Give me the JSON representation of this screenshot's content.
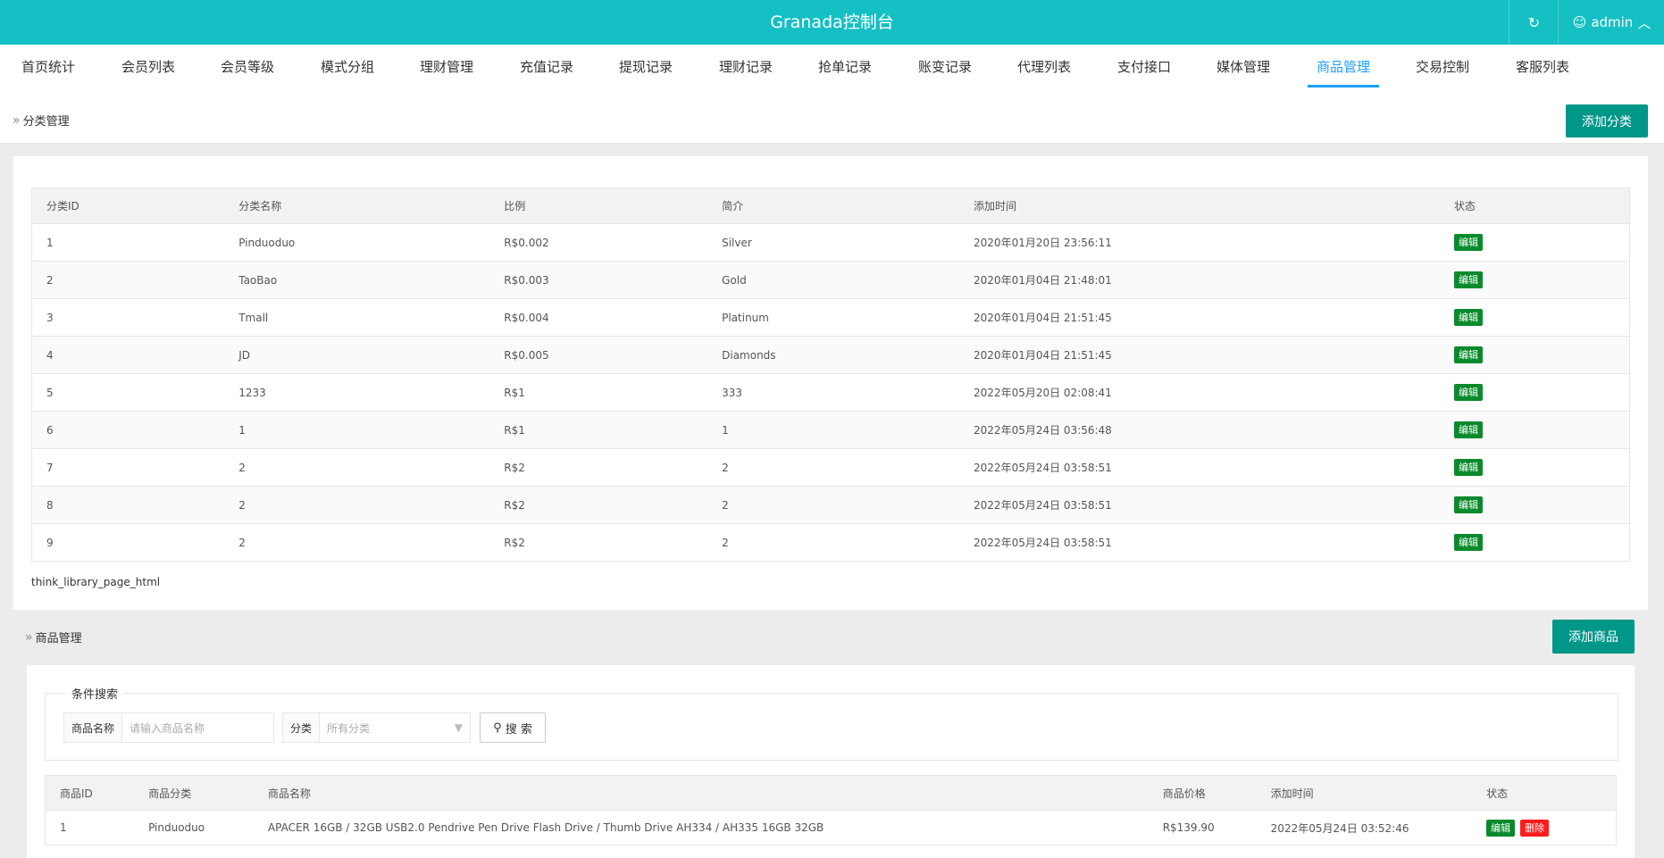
{
  "app": {
    "title": "Granada控制台",
    "user": "admin",
    "colors": {
      "header": "#15c0c4",
      "accent": "#1E9FFF",
      "primary_button": "#009688",
      "edit_tag": "#0a8a2c",
      "delete_tag": "#ff1c1c"
    }
  },
  "nav": {
    "items": [
      "首页统计",
      "会员列表",
      "会员等级",
      "模式分组",
      "理财管理",
      "充值记录",
      "提现记录",
      "理财记录",
      "抢单记录",
      "账变记录",
      "代理列表",
      "支付接口",
      "媒体管理",
      "商品管理",
      "交易控制",
      "客服列表"
    ],
    "active": "商品管理"
  },
  "category": {
    "breadcrumb": "分类管理",
    "add_button": "添加分类",
    "columns": [
      "分类ID",
      "分类名称",
      "比例",
      "简介",
      "添加时间",
      "状态"
    ],
    "rows": [
      [
        "1",
        "Pinduoduo",
        "R$0.002",
        "Silver",
        "2020年01月20日 23:56:11"
      ],
      [
        "2",
        "TaoBao",
        "R$0.003",
        "Gold",
        "2020年01月04日 21:48:01"
      ],
      [
        "3",
        "Tmall",
        "R$0.004",
        "Platinum",
        "2020年01月04日 21:51:45"
      ],
      [
        "4",
        "JD",
        "R$0.005",
        "Diamonds",
        "2020年01月04日 21:51:45"
      ],
      [
        "5",
        "1233",
        "R$1",
        "333",
        "2022年05月20日 02:08:41"
      ],
      [
        "6",
        "1",
        "R$1",
        "1",
        "2022年05月24日 03:56:48"
      ],
      [
        "7",
        "2",
        "R$2",
        "2",
        "2022年05月24日 03:58:51"
      ],
      [
        "8",
        "2",
        "R$2",
        "2",
        "2022年05月24日 03:58:51"
      ],
      [
        "9",
        "2",
        "R$2",
        "2",
        "2022年05月24日 03:58:51"
      ]
    ],
    "edit_label": "编辑",
    "pager_text": "think_library_page_html"
  },
  "goods": {
    "breadcrumb": "商品管理",
    "add_button": "添加商品",
    "search": {
      "legend": "条件搜索",
      "name_label": "商品名称",
      "name_placeholder": "请输入商品名称",
      "category_label": "分类",
      "category_value": "所有分类",
      "button": "搜 索"
    },
    "columns": [
      "商品ID",
      "商品分类",
      "商品名称",
      "商品价格",
      "添加时间",
      "状态"
    ],
    "rows": [
      [
        "1",
        "Pinduoduo",
        "APACER 16GB / 32GB USB2.0 Pendrive Pen Drive Flash Drive / Thumb Drive AH334 / AH335 16GB 32GB",
        "R$139.90",
        "2022年05月24日 03:52:46"
      ]
    ],
    "edit_label": "编辑",
    "delete_label": "删除"
  },
  "icons": {
    "refresh": "refresh-icon",
    "user": "user-icon",
    "chevron_up": "chevron-up-icon",
    "crumb": "double-chevron-icon",
    "search": "search-icon",
    "dropdown": "caret-down-icon"
  }
}
